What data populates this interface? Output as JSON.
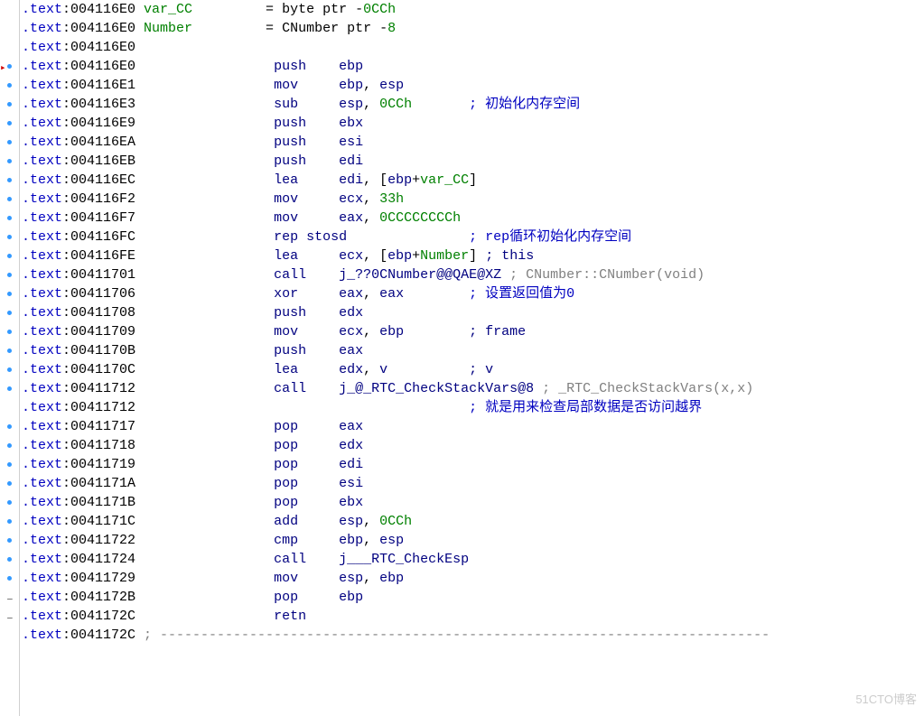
{
  "chart_data": {
    "type": "table",
    "title": "IDA disassembly listing",
    "rows": [
      {
        "addr": "004116E0",
        "label": "var_CC",
        "def": "= byte ptr -0CCh"
      },
      {
        "addr": "004116E0",
        "label": "Number",
        "def": "= CNumber ptr -8"
      },
      {
        "addr": "004116E0"
      },
      {
        "addr": "004116E0",
        "mnem": "push",
        "ops": "ebp"
      },
      {
        "addr": "004116E1",
        "mnem": "mov",
        "ops": "ebp, esp"
      },
      {
        "addr": "004116E3",
        "mnem": "sub",
        "ops": "esp, 0CCh",
        "comment": "初始化内存空间"
      },
      {
        "addr": "004116E9",
        "mnem": "push",
        "ops": "ebx"
      },
      {
        "addr": "004116EA",
        "mnem": "push",
        "ops": "esi"
      },
      {
        "addr": "004116EB",
        "mnem": "push",
        "ops": "edi"
      },
      {
        "addr": "004116EC",
        "mnem": "lea",
        "ops": "edi, [ebp+var_CC]"
      },
      {
        "addr": "004116F2",
        "mnem": "mov",
        "ops": "ecx, 33h"
      },
      {
        "addr": "004116F7",
        "mnem": "mov",
        "ops": "eax, 0CCCCCCCCh"
      },
      {
        "addr": "004116FC",
        "mnem": "rep stosd",
        "comment": "rep循环初始化内存空间"
      },
      {
        "addr": "004116FE",
        "mnem": "lea",
        "ops": "ecx, [ebp+Number]",
        "comment": "this"
      },
      {
        "addr": "00411701",
        "mnem": "call",
        "ops": "j_??0CNumber@@QAE@XZ",
        "comment": "CNumber::CNumber(void)"
      },
      {
        "addr": "00411706",
        "mnem": "xor",
        "ops": "eax, eax",
        "comment": "设置返回值为0"
      },
      {
        "addr": "00411708",
        "mnem": "push",
        "ops": "edx"
      },
      {
        "addr": "00411709",
        "mnem": "mov",
        "ops": "ecx, ebp",
        "comment": "frame"
      },
      {
        "addr": "0041170B",
        "mnem": "push",
        "ops": "eax"
      },
      {
        "addr": "0041170C",
        "mnem": "lea",
        "ops": "edx, v",
        "comment": "v"
      },
      {
        "addr": "00411712",
        "mnem": "call",
        "ops": "j_@_RTC_CheckStackVars@8",
        "comment": "_RTC_CheckStackVars(x,x)"
      },
      {
        "addr": "00411712",
        "comment": "就是用来检查局部数据是否访问越界"
      },
      {
        "addr": "00411717",
        "mnem": "pop",
        "ops": "eax"
      },
      {
        "addr": "00411718",
        "mnem": "pop",
        "ops": "edx"
      },
      {
        "addr": "00411719",
        "mnem": "pop",
        "ops": "edi"
      },
      {
        "addr": "0041171A",
        "mnem": "pop",
        "ops": "esi"
      },
      {
        "addr": "0041171B",
        "mnem": "pop",
        "ops": "ebx"
      },
      {
        "addr": "0041171C",
        "mnem": "add",
        "ops": "esp, 0CCh"
      },
      {
        "addr": "00411722",
        "mnem": "cmp",
        "ops": "ebp, esp"
      },
      {
        "addr": "00411724",
        "mnem": "call",
        "ops": "j___RTC_CheckEsp"
      },
      {
        "addr": "00411729",
        "mnem": "mov",
        "ops": "esp, ebp"
      },
      {
        "addr": "0041172B",
        "mnem": "pop",
        "ops": "ebp"
      },
      {
        "addr": "0041172C",
        "mnem": "retn"
      },
      {
        "addr": "0041172C",
        "sep": true
      }
    ]
  },
  "lines": [
    {
      "gut": "",
      "segs": [
        {
          "c": "seg",
          "t": ".text"
        },
        {
          "c": "addr",
          "t": ":004116E0 "
        },
        {
          "c": "var",
          "t": "var_CC"
        },
        {
          "c": "plain",
          "t": "         = byte ptr -"
        },
        {
          "c": "num",
          "t": "0CCh"
        }
      ]
    },
    {
      "gut": "",
      "segs": [
        {
          "c": "seg",
          "t": ".text"
        },
        {
          "c": "addr",
          "t": ":004116E0 "
        },
        {
          "c": "var",
          "t": "Number"
        },
        {
          "c": "plain",
          "t": "         = CNumber ptr -"
        },
        {
          "c": "num",
          "t": "8"
        }
      ]
    },
    {
      "gut": "",
      "segs": [
        {
          "c": "seg",
          "t": ".text"
        },
        {
          "c": "addr",
          "t": ":004116E0"
        }
      ]
    },
    {
      "gut": "arrow",
      "segs": [
        {
          "c": "seg",
          "t": ".text"
        },
        {
          "c": "addr",
          "t": ":004116E0                 "
        },
        {
          "c": "kw",
          "t": "push"
        },
        {
          "c": "plain",
          "t": "    "
        },
        {
          "c": "reg",
          "t": "ebp"
        }
      ]
    },
    {
      "gut": "dot",
      "segs": [
        {
          "c": "seg",
          "t": ".text"
        },
        {
          "c": "addr",
          "t": ":004116E1                 "
        },
        {
          "c": "kw",
          "t": "mov"
        },
        {
          "c": "plain",
          "t": "     "
        },
        {
          "c": "reg",
          "t": "ebp"
        },
        {
          "c": "plain",
          "t": ", "
        },
        {
          "c": "reg",
          "t": "esp"
        }
      ]
    },
    {
      "gut": "dot",
      "segs": [
        {
          "c": "seg",
          "t": ".text"
        },
        {
          "c": "addr",
          "t": ":004116E3                 "
        },
        {
          "c": "kw",
          "t": "sub"
        },
        {
          "c": "plain",
          "t": "     "
        },
        {
          "c": "reg",
          "t": "esp"
        },
        {
          "c": "plain",
          "t": ", "
        },
        {
          "c": "num",
          "t": "0CCh"
        },
        {
          "c": "plain",
          "t": "       "
        },
        {
          "c": "cm",
          "t": "; 初始化内存空间"
        }
      ]
    },
    {
      "gut": "dot",
      "segs": [
        {
          "c": "seg",
          "t": ".text"
        },
        {
          "c": "addr",
          "t": ":004116E9                 "
        },
        {
          "c": "kw",
          "t": "push"
        },
        {
          "c": "plain",
          "t": "    "
        },
        {
          "c": "reg",
          "t": "ebx"
        }
      ]
    },
    {
      "gut": "dot",
      "segs": [
        {
          "c": "seg",
          "t": ".text"
        },
        {
          "c": "addr",
          "t": ":004116EA                 "
        },
        {
          "c": "kw",
          "t": "push"
        },
        {
          "c": "plain",
          "t": "    "
        },
        {
          "c": "reg",
          "t": "esi"
        }
      ]
    },
    {
      "gut": "dot",
      "segs": [
        {
          "c": "seg",
          "t": ".text"
        },
        {
          "c": "addr",
          "t": ":004116EB                 "
        },
        {
          "c": "kw",
          "t": "push"
        },
        {
          "c": "plain",
          "t": "    "
        },
        {
          "c": "reg",
          "t": "edi"
        }
      ]
    },
    {
      "gut": "dot",
      "segs": [
        {
          "c": "seg",
          "t": ".text"
        },
        {
          "c": "addr",
          "t": ":004116EC                 "
        },
        {
          "c": "kw",
          "t": "lea"
        },
        {
          "c": "plain",
          "t": "     "
        },
        {
          "c": "reg",
          "t": "edi"
        },
        {
          "c": "plain",
          "t": ", ["
        },
        {
          "c": "reg",
          "t": "ebp"
        },
        {
          "c": "plain",
          "t": "+"
        },
        {
          "c": "var",
          "t": "var_CC"
        },
        {
          "c": "plain",
          "t": "]"
        }
      ]
    },
    {
      "gut": "dot",
      "segs": [
        {
          "c": "seg",
          "t": ".text"
        },
        {
          "c": "addr",
          "t": ":004116F2                 "
        },
        {
          "c": "kw",
          "t": "mov"
        },
        {
          "c": "plain",
          "t": "     "
        },
        {
          "c": "reg",
          "t": "ecx"
        },
        {
          "c": "plain",
          "t": ", "
        },
        {
          "c": "num",
          "t": "33h"
        }
      ]
    },
    {
      "gut": "dot",
      "segs": [
        {
          "c": "seg",
          "t": ".text"
        },
        {
          "c": "addr",
          "t": ":004116F7                 "
        },
        {
          "c": "kw",
          "t": "mov"
        },
        {
          "c": "plain",
          "t": "     "
        },
        {
          "c": "reg",
          "t": "eax"
        },
        {
          "c": "plain",
          "t": ", "
        },
        {
          "c": "num",
          "t": "0CCCCCCCCh"
        }
      ]
    },
    {
      "gut": "dot",
      "segs": [
        {
          "c": "seg",
          "t": ".text"
        },
        {
          "c": "addr",
          "t": ":004116FC                 "
        },
        {
          "c": "kw",
          "t": "rep stosd"
        },
        {
          "c": "plain",
          "t": "               "
        },
        {
          "c": "cm",
          "t": "; rep循环初始化内存空间"
        }
      ]
    },
    {
      "gut": "dot",
      "segs": [
        {
          "c": "seg",
          "t": ".text"
        },
        {
          "c": "addr",
          "t": ":004116FE                 "
        },
        {
          "c": "kw",
          "t": "lea"
        },
        {
          "c": "plain",
          "t": "     "
        },
        {
          "c": "reg",
          "t": "ecx"
        },
        {
          "c": "plain",
          "t": ", ["
        },
        {
          "c": "reg",
          "t": "ebp"
        },
        {
          "c": "plain",
          "t": "+"
        },
        {
          "c": "var",
          "t": "Number"
        },
        {
          "c": "plain",
          "t": "] "
        },
        {
          "c": "cn",
          "t": "; this"
        }
      ]
    },
    {
      "gut": "dot",
      "segs": [
        {
          "c": "seg",
          "t": ".text"
        },
        {
          "c": "addr",
          "t": ":00411701                 "
        },
        {
          "c": "kw",
          "t": "call"
        },
        {
          "c": "plain",
          "t": "    "
        },
        {
          "c": "label",
          "t": "j_??0CNumber@@QAE@XZ"
        },
        {
          "c": "plain",
          "t": " "
        },
        {
          "c": "cg",
          "t": "; CNumber::CNumber(void)"
        }
      ]
    },
    {
      "gut": "dot",
      "segs": [
        {
          "c": "seg",
          "t": ".text"
        },
        {
          "c": "addr",
          "t": ":00411706                 "
        },
        {
          "c": "kw",
          "t": "xor"
        },
        {
          "c": "plain",
          "t": "     "
        },
        {
          "c": "reg",
          "t": "eax"
        },
        {
          "c": "plain",
          "t": ", "
        },
        {
          "c": "reg",
          "t": "eax"
        },
        {
          "c": "plain",
          "t": "        "
        },
        {
          "c": "cm",
          "t": "; 设置返回值为0"
        }
      ]
    },
    {
      "gut": "dot",
      "segs": [
        {
          "c": "seg",
          "t": ".text"
        },
        {
          "c": "addr",
          "t": ":00411708                 "
        },
        {
          "c": "kw",
          "t": "push"
        },
        {
          "c": "plain",
          "t": "    "
        },
        {
          "c": "reg",
          "t": "edx"
        }
      ]
    },
    {
      "gut": "dot",
      "segs": [
        {
          "c": "seg",
          "t": ".text"
        },
        {
          "c": "addr",
          "t": ":00411709                 "
        },
        {
          "c": "kw",
          "t": "mov"
        },
        {
          "c": "plain",
          "t": "     "
        },
        {
          "c": "reg",
          "t": "ecx"
        },
        {
          "c": "plain",
          "t": ", "
        },
        {
          "c": "reg",
          "t": "ebp"
        },
        {
          "c": "plain",
          "t": "        "
        },
        {
          "c": "cn",
          "t": "; frame"
        }
      ]
    },
    {
      "gut": "dot",
      "segs": [
        {
          "c": "seg",
          "t": ".text"
        },
        {
          "c": "addr",
          "t": ":0041170B                 "
        },
        {
          "c": "kw",
          "t": "push"
        },
        {
          "c": "plain",
          "t": "    "
        },
        {
          "c": "reg",
          "t": "eax"
        }
      ]
    },
    {
      "gut": "dot",
      "segs": [
        {
          "c": "seg",
          "t": ".text"
        },
        {
          "c": "addr",
          "t": ":0041170C                 "
        },
        {
          "c": "kw",
          "t": "lea"
        },
        {
          "c": "plain",
          "t": "     "
        },
        {
          "c": "reg",
          "t": "edx"
        },
        {
          "c": "plain",
          "t": ", "
        },
        {
          "c": "label",
          "t": "v"
        },
        {
          "c": "plain",
          "t": "          "
        },
        {
          "c": "cn",
          "t": "; v"
        }
      ]
    },
    {
      "gut": "dot",
      "segs": [
        {
          "c": "seg",
          "t": ".text"
        },
        {
          "c": "addr",
          "t": ":00411712                 "
        },
        {
          "c": "kw",
          "t": "call"
        },
        {
          "c": "plain",
          "t": "    "
        },
        {
          "c": "label",
          "t": "j_@_RTC_CheckStackVars@8"
        },
        {
          "c": "plain",
          "t": " "
        },
        {
          "c": "cg",
          "t": "; _RTC_CheckStackVars(x,x)"
        }
      ]
    },
    {
      "gut": "",
      "segs": [
        {
          "c": "seg",
          "t": ".text"
        },
        {
          "c": "addr",
          "t": ":00411712                                         "
        },
        {
          "c": "cm",
          "t": "; 就是用来检查局部数据是否访问越界"
        }
      ]
    },
    {
      "gut": "dot",
      "segs": [
        {
          "c": "seg",
          "t": ".text"
        },
        {
          "c": "addr",
          "t": ":00411717                 "
        },
        {
          "c": "kw",
          "t": "pop"
        },
        {
          "c": "plain",
          "t": "     "
        },
        {
          "c": "reg",
          "t": "eax"
        }
      ]
    },
    {
      "gut": "dot",
      "segs": [
        {
          "c": "seg",
          "t": ".text"
        },
        {
          "c": "addr",
          "t": ":00411718                 "
        },
        {
          "c": "kw",
          "t": "pop"
        },
        {
          "c": "plain",
          "t": "     "
        },
        {
          "c": "reg",
          "t": "edx"
        }
      ]
    },
    {
      "gut": "dot",
      "segs": [
        {
          "c": "seg",
          "t": ".text"
        },
        {
          "c": "addr",
          "t": ":00411719                 "
        },
        {
          "c": "kw",
          "t": "pop"
        },
        {
          "c": "plain",
          "t": "     "
        },
        {
          "c": "reg",
          "t": "edi"
        }
      ]
    },
    {
      "gut": "dot",
      "segs": [
        {
          "c": "seg",
          "t": ".text"
        },
        {
          "c": "addr",
          "t": ":0041171A                 "
        },
        {
          "c": "kw",
          "t": "pop"
        },
        {
          "c": "plain",
          "t": "     "
        },
        {
          "c": "reg",
          "t": "esi"
        }
      ]
    },
    {
      "gut": "dot",
      "segs": [
        {
          "c": "seg",
          "t": ".text"
        },
        {
          "c": "addr",
          "t": ":0041171B                 "
        },
        {
          "c": "kw",
          "t": "pop"
        },
        {
          "c": "plain",
          "t": "     "
        },
        {
          "c": "reg",
          "t": "ebx"
        }
      ]
    },
    {
      "gut": "dot",
      "segs": [
        {
          "c": "seg",
          "t": ".text"
        },
        {
          "c": "addr",
          "t": ":0041171C                 "
        },
        {
          "c": "kw",
          "t": "add"
        },
        {
          "c": "plain",
          "t": "     "
        },
        {
          "c": "reg",
          "t": "esp"
        },
        {
          "c": "plain",
          "t": ", "
        },
        {
          "c": "num",
          "t": "0CCh"
        }
      ]
    },
    {
      "gut": "dot",
      "segs": [
        {
          "c": "seg",
          "t": ".text"
        },
        {
          "c": "addr",
          "t": ":00411722                 "
        },
        {
          "c": "kw",
          "t": "cmp"
        },
        {
          "c": "plain",
          "t": "     "
        },
        {
          "c": "reg",
          "t": "ebp"
        },
        {
          "c": "plain",
          "t": ", "
        },
        {
          "c": "reg",
          "t": "esp"
        }
      ]
    },
    {
      "gut": "dot",
      "segs": [
        {
          "c": "seg",
          "t": ".text"
        },
        {
          "c": "addr",
          "t": ":00411724                 "
        },
        {
          "c": "kw",
          "t": "call"
        },
        {
          "c": "plain",
          "t": "    "
        },
        {
          "c": "label",
          "t": "j___RTC_CheckEsp"
        }
      ]
    },
    {
      "gut": "dot",
      "segs": [
        {
          "c": "seg",
          "t": ".text"
        },
        {
          "c": "addr",
          "t": ":00411729                 "
        },
        {
          "c": "kw",
          "t": "mov"
        },
        {
          "c": "plain",
          "t": "     "
        },
        {
          "c": "reg",
          "t": "esp"
        },
        {
          "c": "plain",
          "t": ", "
        },
        {
          "c": "reg",
          "t": "ebp"
        }
      ]
    },
    {
      "gut": "dash",
      "segs": [
        {
          "c": "seg",
          "t": ".text"
        },
        {
          "c": "addr",
          "t": ":0041172B                 "
        },
        {
          "c": "kw",
          "t": "pop"
        },
        {
          "c": "plain",
          "t": "     "
        },
        {
          "c": "reg",
          "t": "ebp"
        }
      ]
    },
    {
      "gut": "dash",
      "segs": [
        {
          "c": "seg",
          "t": ".text"
        },
        {
          "c": "addr",
          "t": ":0041172C                 "
        },
        {
          "c": "kw",
          "t": "retn"
        }
      ]
    },
    {
      "gut": "",
      "segs": [
        {
          "c": "seg",
          "t": ".text"
        },
        {
          "c": "addr",
          "t": ":0041172C "
        },
        {
          "c": "cg",
          "t": "; ---------------------------------------------------------------------------"
        }
      ]
    }
  ],
  "watermark": "51CTO博客"
}
